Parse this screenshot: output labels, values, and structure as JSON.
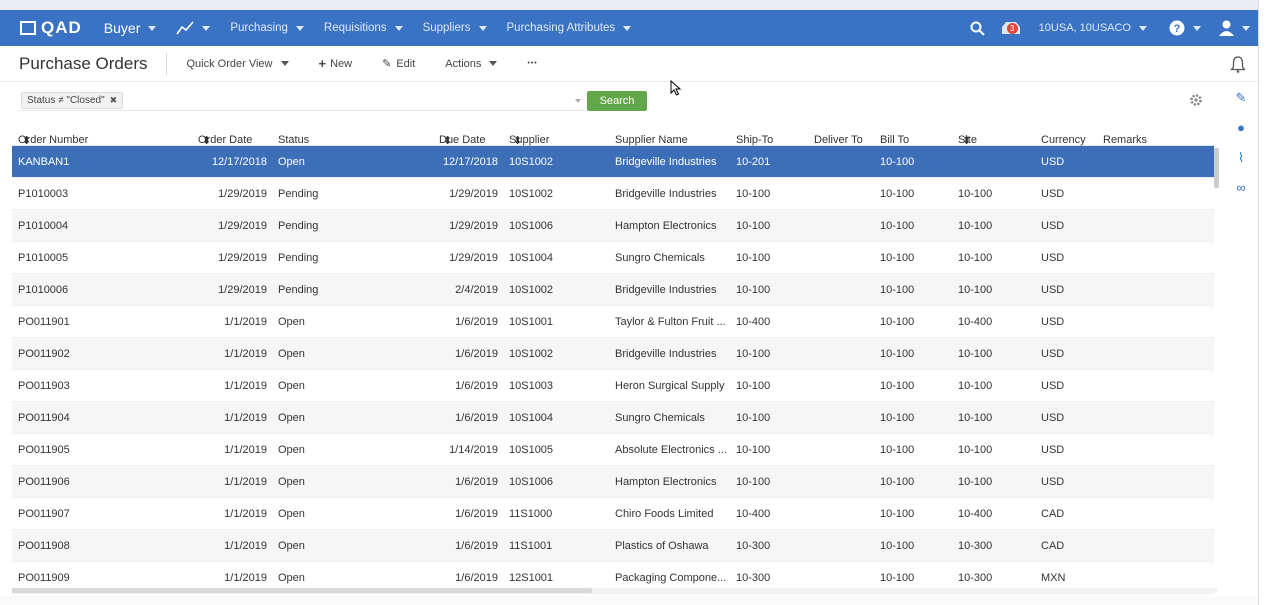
{
  "nav": {
    "logo": "QAD",
    "role": "Buyer",
    "items": [
      "Purchasing",
      "Requisitions",
      "Suppliers",
      "Purchasing Attributes"
    ],
    "notification_count": "3",
    "domain": "10USA, 10USACO"
  },
  "page": {
    "title": "Purchase Orders",
    "view_label": "Quick Order View",
    "new_label": "New",
    "edit_label": "Edit",
    "actions_label": "Actions",
    "more_label": "•••"
  },
  "filter": {
    "chip_label": "Status ≠ \"Closed\"",
    "search_label": "Search"
  },
  "columns": [
    "Order Number",
    "Order Date",
    "Status",
    "Due Date",
    "Supplier",
    "Supplier Name",
    "Ship-To",
    "Deliver To",
    "Bill To",
    "Site",
    "Currency",
    "Remarks"
  ],
  "rows": [
    {
      "order": "KANBAN1",
      "order_date": "12/17/2018",
      "status": "Open",
      "due": "12/17/2018",
      "supplier": "10S1002",
      "name": "Bridgeville Industries",
      "ship": "10-201",
      "deliver": "",
      "bill": "10-100",
      "site": "",
      "currency": "USD",
      "remarks": ""
    },
    {
      "order": "P1010003",
      "order_date": "1/29/2019",
      "status": "Pending",
      "due": "1/29/2019",
      "supplier": "10S1002",
      "name": "Bridgeville Industries",
      "ship": "10-100",
      "deliver": "",
      "bill": "10-100",
      "site": "10-100",
      "currency": "USD",
      "remarks": ""
    },
    {
      "order": "P1010004",
      "order_date": "1/29/2019",
      "status": "Pending",
      "due": "1/29/2019",
      "supplier": "10S1006",
      "name": "Hampton Electronics",
      "ship": "10-100",
      "deliver": "",
      "bill": "10-100",
      "site": "10-100",
      "currency": "USD",
      "remarks": ""
    },
    {
      "order": "P1010005",
      "order_date": "1/29/2019",
      "status": "Pending",
      "due": "1/29/2019",
      "supplier": "10S1004",
      "name": "Sungro Chemicals",
      "ship": "10-100",
      "deliver": "",
      "bill": "10-100",
      "site": "10-100",
      "currency": "USD",
      "remarks": ""
    },
    {
      "order": "P1010006",
      "order_date": "1/29/2019",
      "status": "Pending",
      "due": "2/4/2019",
      "supplier": "10S1002",
      "name": "Bridgeville Industries",
      "ship": "10-100",
      "deliver": "",
      "bill": "10-100",
      "site": "10-100",
      "currency": "USD",
      "remarks": ""
    },
    {
      "order": "PO011901",
      "order_date": "1/1/2019",
      "status": "Open",
      "due": "1/6/2019",
      "supplier": "10S1001",
      "name": "Taylor & Fulton Fruit ...",
      "ship": "10-400",
      "deliver": "",
      "bill": "10-100",
      "site": "10-400",
      "currency": "USD",
      "remarks": ""
    },
    {
      "order": "PO011902",
      "order_date": "1/1/2019",
      "status": "Open",
      "due": "1/6/2019",
      "supplier": "10S1002",
      "name": "Bridgeville Industries",
      "ship": "10-100",
      "deliver": "",
      "bill": "10-100",
      "site": "10-100",
      "currency": "USD",
      "remarks": ""
    },
    {
      "order": "PO011903",
      "order_date": "1/1/2019",
      "status": "Open",
      "due": "1/6/2019",
      "supplier": "10S1003",
      "name": "Heron Surgical Supply",
      "ship": "10-100",
      "deliver": "",
      "bill": "10-100",
      "site": "10-100",
      "currency": "USD",
      "remarks": ""
    },
    {
      "order": "PO011904",
      "order_date": "1/1/2019",
      "status": "Open",
      "due": "1/6/2019",
      "supplier": "10S1004",
      "name": "Sungro Chemicals",
      "ship": "10-100",
      "deliver": "",
      "bill": "10-100",
      "site": "10-100",
      "currency": "USD",
      "remarks": ""
    },
    {
      "order": "PO011905",
      "order_date": "1/1/2019",
      "status": "Open",
      "due": "1/14/2019",
      "supplier": "10S1005",
      "name": "Absolute Electronics ...",
      "ship": "10-100",
      "deliver": "",
      "bill": "10-100",
      "site": "10-100",
      "currency": "USD",
      "remarks": ""
    },
    {
      "order": "PO011906",
      "order_date": "1/1/2019",
      "status": "Open",
      "due": "1/6/2019",
      "supplier": "10S1006",
      "name": "Hampton Electronics",
      "ship": "10-100",
      "deliver": "",
      "bill": "10-100",
      "site": "10-100",
      "currency": "USD",
      "remarks": ""
    },
    {
      "order": "PO011907",
      "order_date": "1/1/2019",
      "status": "Open",
      "due": "1/6/2019",
      "supplier": "11S1000",
      "name": "Chiro Foods Limited",
      "ship": "10-400",
      "deliver": "",
      "bill": "10-100",
      "site": "10-400",
      "currency": "CAD",
      "remarks": ""
    },
    {
      "order": "PO011908",
      "order_date": "1/1/2019",
      "status": "Open",
      "due": "1/6/2019",
      "supplier": "11S1001",
      "name": "Plastics of Oshawa",
      "ship": "10-300",
      "deliver": "",
      "bill": "10-100",
      "site": "10-300",
      "currency": "CAD",
      "remarks": ""
    },
    {
      "order": "PO011909",
      "order_date": "1/1/2019",
      "status": "Open",
      "due": "1/6/2019",
      "supplier": "12S1001",
      "name": "Packaging Compone...",
      "ship": "10-300",
      "deliver": "",
      "bill": "10-100",
      "site": "10-300",
      "currency": "MXN",
      "remarks": ""
    }
  ]
}
